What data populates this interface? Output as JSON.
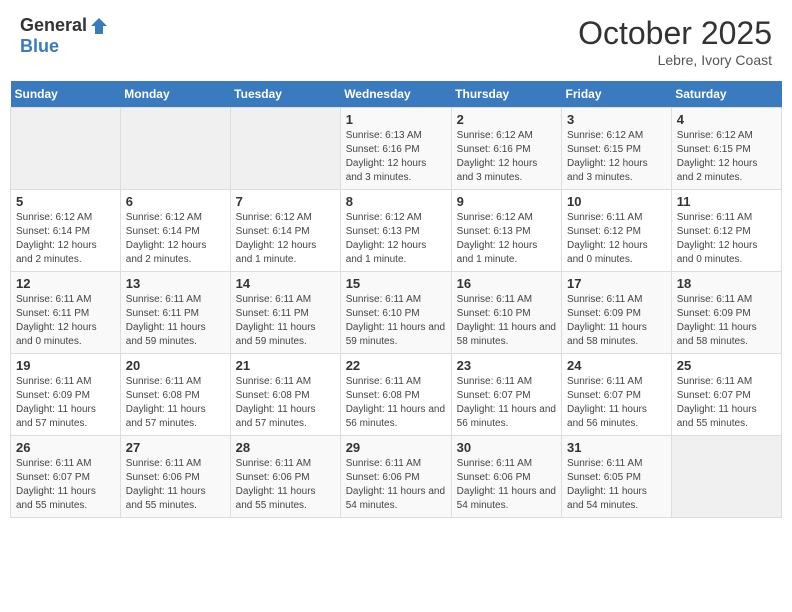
{
  "header": {
    "logo_general": "General",
    "logo_blue": "Blue",
    "month_title": "October 2025",
    "location": "Lebre, Ivory Coast"
  },
  "days_of_week": [
    "Sunday",
    "Monday",
    "Tuesday",
    "Wednesday",
    "Thursday",
    "Friday",
    "Saturday"
  ],
  "weeks": [
    [
      {
        "day": "",
        "info": ""
      },
      {
        "day": "",
        "info": ""
      },
      {
        "day": "",
        "info": ""
      },
      {
        "day": "1",
        "info": "Sunrise: 6:13 AM\nSunset: 6:16 PM\nDaylight: 12 hours and 3 minutes."
      },
      {
        "day": "2",
        "info": "Sunrise: 6:12 AM\nSunset: 6:16 PM\nDaylight: 12 hours and 3 minutes."
      },
      {
        "day": "3",
        "info": "Sunrise: 6:12 AM\nSunset: 6:15 PM\nDaylight: 12 hours and 3 minutes."
      },
      {
        "day": "4",
        "info": "Sunrise: 6:12 AM\nSunset: 6:15 PM\nDaylight: 12 hours and 2 minutes."
      }
    ],
    [
      {
        "day": "5",
        "info": "Sunrise: 6:12 AM\nSunset: 6:14 PM\nDaylight: 12 hours and 2 minutes."
      },
      {
        "day": "6",
        "info": "Sunrise: 6:12 AM\nSunset: 6:14 PM\nDaylight: 12 hours and 2 minutes."
      },
      {
        "day": "7",
        "info": "Sunrise: 6:12 AM\nSunset: 6:14 PM\nDaylight: 12 hours and 1 minute."
      },
      {
        "day": "8",
        "info": "Sunrise: 6:12 AM\nSunset: 6:13 PM\nDaylight: 12 hours and 1 minute."
      },
      {
        "day": "9",
        "info": "Sunrise: 6:12 AM\nSunset: 6:13 PM\nDaylight: 12 hours and 1 minute."
      },
      {
        "day": "10",
        "info": "Sunrise: 6:11 AM\nSunset: 6:12 PM\nDaylight: 12 hours and 0 minutes."
      },
      {
        "day": "11",
        "info": "Sunrise: 6:11 AM\nSunset: 6:12 PM\nDaylight: 12 hours and 0 minutes."
      }
    ],
    [
      {
        "day": "12",
        "info": "Sunrise: 6:11 AM\nSunset: 6:11 PM\nDaylight: 12 hours and 0 minutes."
      },
      {
        "day": "13",
        "info": "Sunrise: 6:11 AM\nSunset: 6:11 PM\nDaylight: 11 hours and 59 minutes."
      },
      {
        "day": "14",
        "info": "Sunrise: 6:11 AM\nSunset: 6:11 PM\nDaylight: 11 hours and 59 minutes."
      },
      {
        "day": "15",
        "info": "Sunrise: 6:11 AM\nSunset: 6:10 PM\nDaylight: 11 hours and 59 minutes."
      },
      {
        "day": "16",
        "info": "Sunrise: 6:11 AM\nSunset: 6:10 PM\nDaylight: 11 hours and 58 minutes."
      },
      {
        "day": "17",
        "info": "Sunrise: 6:11 AM\nSunset: 6:09 PM\nDaylight: 11 hours and 58 minutes."
      },
      {
        "day": "18",
        "info": "Sunrise: 6:11 AM\nSunset: 6:09 PM\nDaylight: 11 hours and 58 minutes."
      }
    ],
    [
      {
        "day": "19",
        "info": "Sunrise: 6:11 AM\nSunset: 6:09 PM\nDaylight: 11 hours and 57 minutes."
      },
      {
        "day": "20",
        "info": "Sunrise: 6:11 AM\nSunset: 6:08 PM\nDaylight: 11 hours and 57 minutes."
      },
      {
        "day": "21",
        "info": "Sunrise: 6:11 AM\nSunset: 6:08 PM\nDaylight: 11 hours and 57 minutes."
      },
      {
        "day": "22",
        "info": "Sunrise: 6:11 AM\nSunset: 6:08 PM\nDaylight: 11 hours and 56 minutes."
      },
      {
        "day": "23",
        "info": "Sunrise: 6:11 AM\nSunset: 6:07 PM\nDaylight: 11 hours and 56 minutes."
      },
      {
        "day": "24",
        "info": "Sunrise: 6:11 AM\nSunset: 6:07 PM\nDaylight: 11 hours and 56 minutes."
      },
      {
        "day": "25",
        "info": "Sunrise: 6:11 AM\nSunset: 6:07 PM\nDaylight: 11 hours and 55 minutes."
      }
    ],
    [
      {
        "day": "26",
        "info": "Sunrise: 6:11 AM\nSunset: 6:07 PM\nDaylight: 11 hours and 55 minutes."
      },
      {
        "day": "27",
        "info": "Sunrise: 6:11 AM\nSunset: 6:06 PM\nDaylight: 11 hours and 55 minutes."
      },
      {
        "day": "28",
        "info": "Sunrise: 6:11 AM\nSunset: 6:06 PM\nDaylight: 11 hours and 55 minutes."
      },
      {
        "day": "29",
        "info": "Sunrise: 6:11 AM\nSunset: 6:06 PM\nDaylight: 11 hours and 54 minutes."
      },
      {
        "day": "30",
        "info": "Sunrise: 6:11 AM\nSunset: 6:06 PM\nDaylight: 11 hours and 54 minutes."
      },
      {
        "day": "31",
        "info": "Sunrise: 6:11 AM\nSunset: 6:05 PM\nDaylight: 11 hours and 54 minutes."
      },
      {
        "day": "",
        "info": ""
      }
    ]
  ]
}
